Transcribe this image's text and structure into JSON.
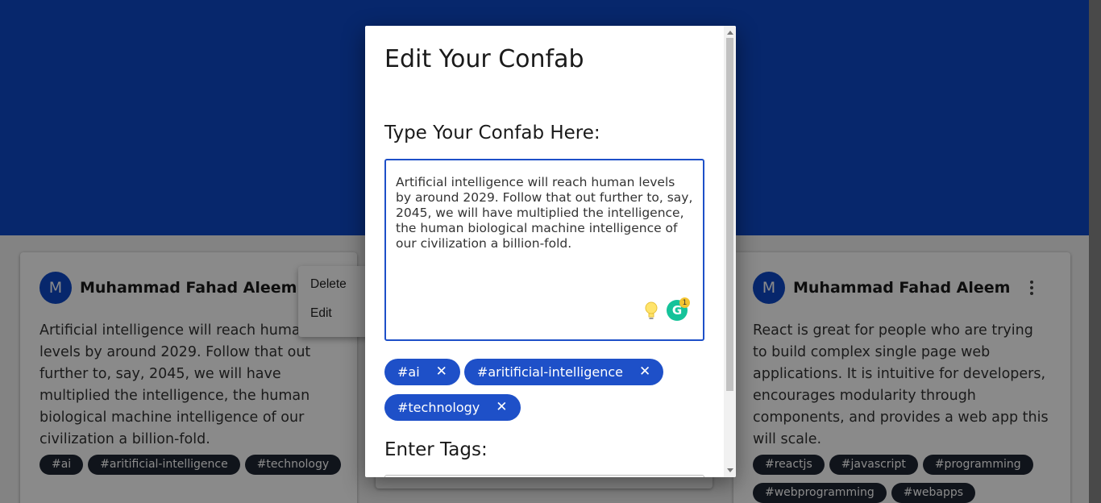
{
  "cards": [
    {
      "avatar_letter": "M",
      "author": "Muhammad Fahad Aleem",
      "text": "Artificial intelligence will reach human levels by around 2029. Follow that out further to, say, 2045, we will have multiplied the intelligence, the human biological machine intelligence of our civilization a billion-fold.",
      "tags": [
        "#ai",
        "#aritificial-intelligence",
        "#technology"
      ]
    },
    {
      "avatar_letter": "M",
      "author": "Muhammad Fahad Aleem",
      "text": "React is great for people who are trying to build complex single page web applications. It is intuitive for developers, encourages modularity through components, and provides a web app this will scale.",
      "tags": [
        "#reactjs",
        "#javascript",
        "#programming",
        "#webprogramming",
        "#webapps"
      ]
    }
  ],
  "context_menu": {
    "items": [
      "Delete",
      "Edit"
    ]
  },
  "modal": {
    "title": "Edit Your Confab",
    "confab_label": "Type Your Confab Here:",
    "confab_value": "Artificial intelligence will reach human levels by around 2029. Follow that out further to, say, 2045, we will have multiplied the intelligence, the human biological machine intelligence of our civilization a billion-fold.",
    "grammarly_letter": "G",
    "grammarly_count": "1",
    "chips": [
      "#ai",
      "#aritificial-intelligence",
      "#technology"
    ],
    "chip_remove": "✕",
    "tags_label": "Enter Tags:"
  },
  "colors": {
    "brand": "#0d48c8",
    "chip": "#1e50c8",
    "tag_dark": "#1f2533",
    "grammarly": "#15c39a"
  }
}
